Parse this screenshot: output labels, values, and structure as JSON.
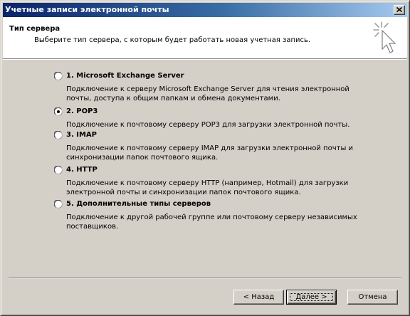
{
  "window": {
    "title": "Учетные записи электронной почты",
    "close_icon": "close-icon"
  },
  "header": {
    "title": "Тип сервера",
    "subtitle": "Выберите тип сервера, с которым будет работать новая учетная запись.",
    "icon": "wizard-cursor-icon"
  },
  "options": [
    {
      "label": "1. Microsoft Exchange Server",
      "description": "Подключение к серверу Microsoft Exchange Server для чтения электронной почты, доступа к общим папкам и обмена документами.",
      "selected": false
    },
    {
      "label": "2. POP3",
      "description": "Подключение к почтовому серверу POP3 для загрузки электронной почты.",
      "selected": true
    },
    {
      "label": "3. IMAP",
      "description": "Подключение к почтовому серверу IMAP для загрузки электронной почты и синхронизации папок почтового ящика.",
      "selected": false
    },
    {
      "label": "4. HTTP",
      "description": "Подключение к почтовому серверу HTTP (например, Hotmail) для загрузки электронной почты и синхронизации папок почтового ящика.",
      "selected": false
    },
    {
      "label": "5. Дополнительные типы серверов",
      "description": "Подключение к другой рабочей группе или почтовому серверу независимых поставщиков.",
      "selected": false
    }
  ],
  "buttons": {
    "back": "< Назад",
    "next": "Далее >",
    "cancel": "Отмена"
  }
}
